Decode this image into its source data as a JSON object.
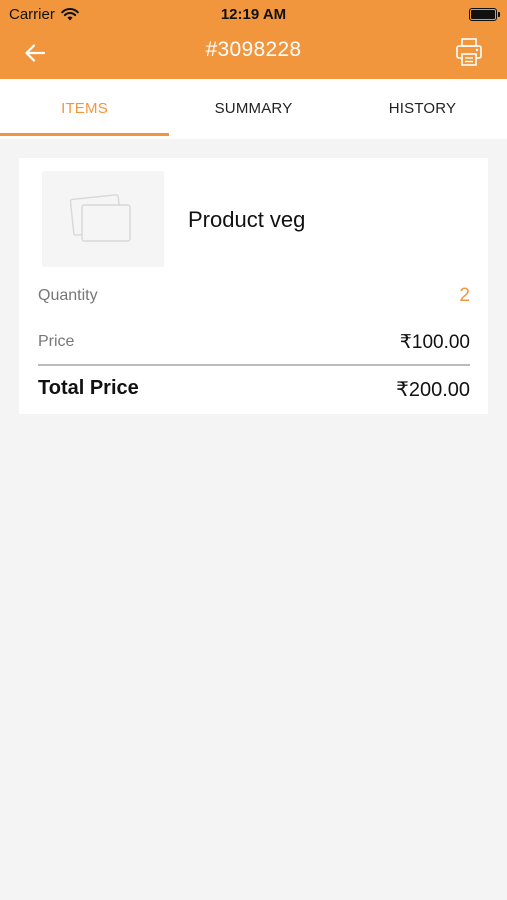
{
  "status_bar": {
    "carrier": "Carrier",
    "time": "12:19 AM"
  },
  "nav": {
    "title": "#3098228"
  },
  "tabs": [
    {
      "label": "ITEMS",
      "active": true
    },
    {
      "label": "SUMMARY",
      "active": false
    },
    {
      "label": "HISTORY",
      "active": false
    }
  ],
  "item": {
    "name": "Product veg",
    "quantity_label": "Quantity",
    "quantity_value": "2",
    "price_label": "Price",
    "price_value": "₹100.00",
    "total_label": "Total Price",
    "total_value": "₹200.00"
  },
  "colors": {
    "accent": "#f2963e",
    "background": "#f4f4f4"
  },
  "icons": [
    "wifi-icon",
    "battery-icon",
    "back-arrow-icon",
    "printer-icon",
    "image-placeholder-icon"
  ]
}
